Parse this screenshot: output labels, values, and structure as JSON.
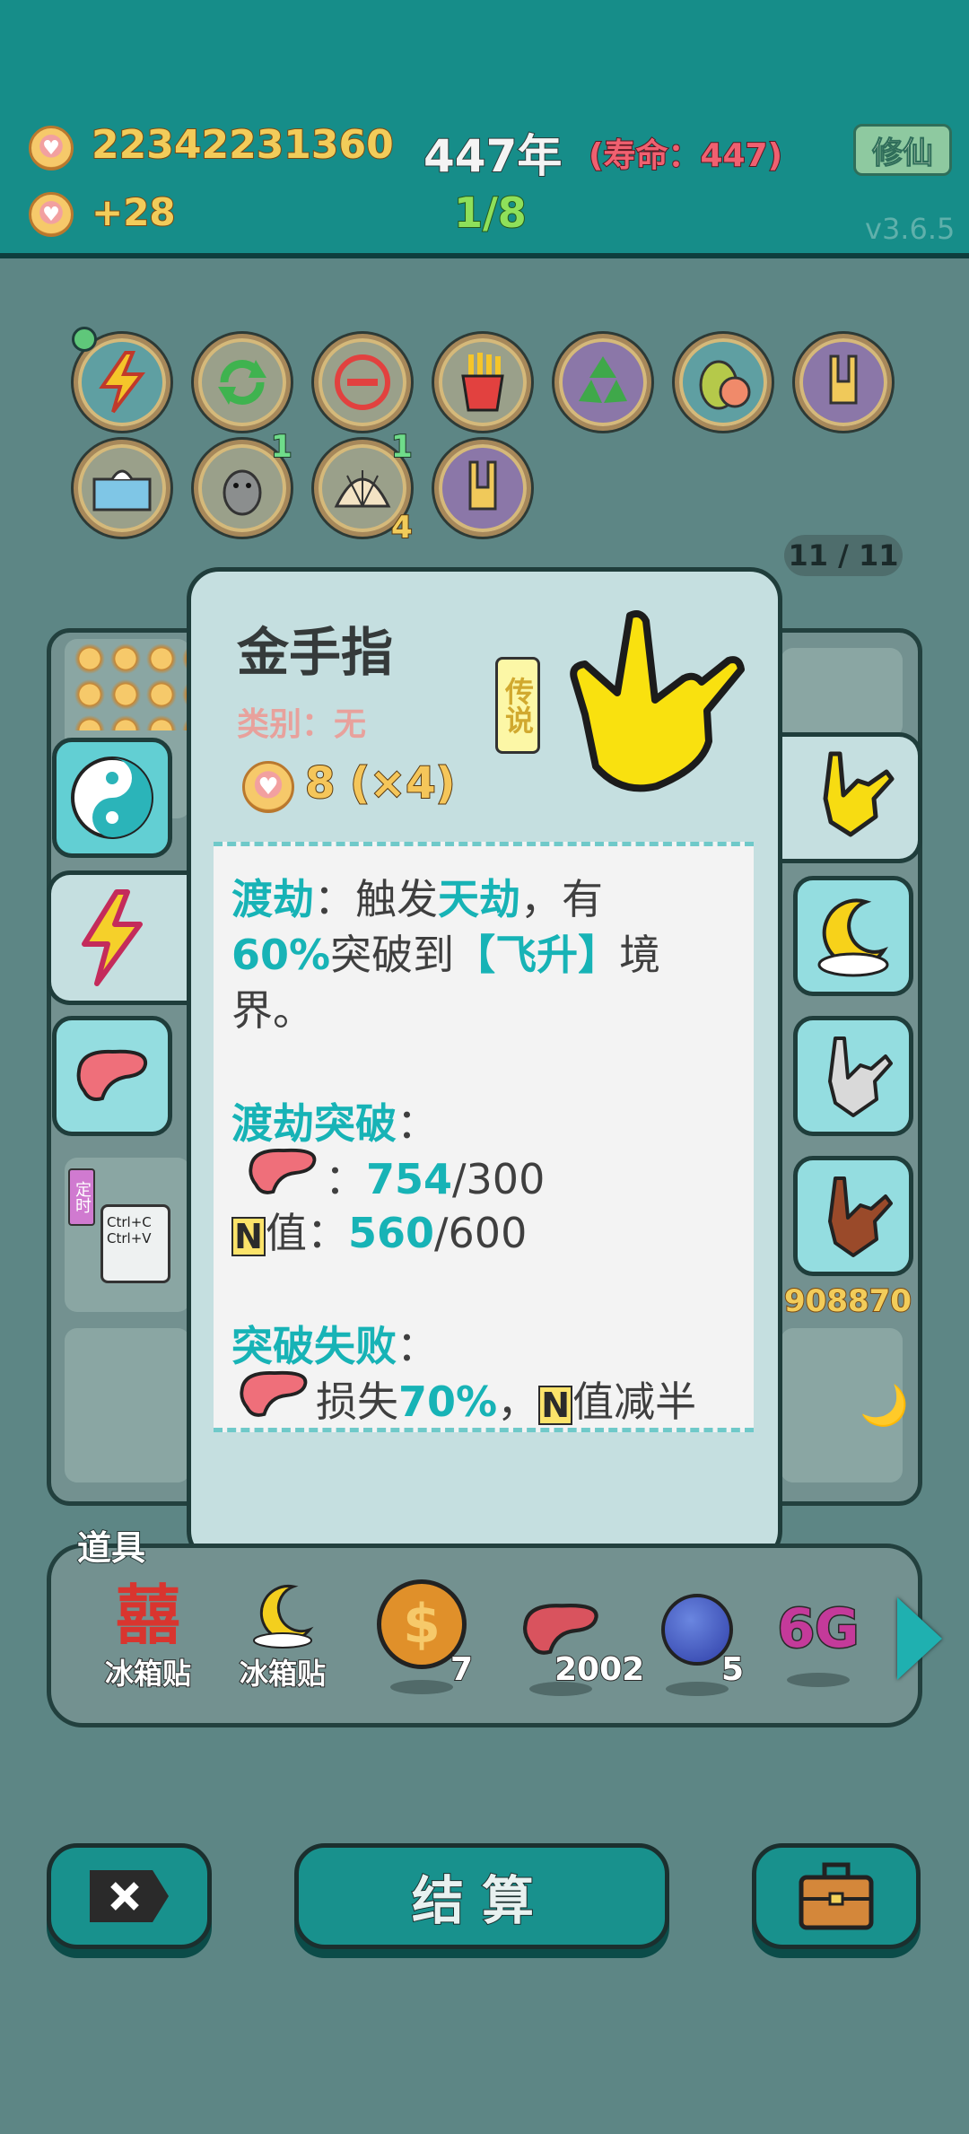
{
  "header": {
    "coins": "22342231360",
    "coin_gain": "+28",
    "year": "447年",
    "lifespan": "(寿命：447)",
    "progress": "1/8",
    "cultivate_button": "修仙",
    "version": "v3.6.5"
  },
  "relics": {
    "row1": [
      "lightning-relic",
      "refresh-relic",
      "minus-relic",
      "fries-relic",
      "recycle-relic",
      "pomelo-relic",
      "rock-hand-relic"
    ],
    "row2": [
      {
        "icon": "tissue-relic",
        "top_count": "",
        "bottom_count": ""
      },
      {
        "icon": "dog-relic",
        "top_count": "1",
        "bottom_count": ""
      },
      {
        "icon": "shell-relic",
        "top_count": "1",
        "bottom_count": "4"
      },
      {
        "icon": "rock-hand-relic-2",
        "top_count": "",
        "bottom_count": ""
      }
    ],
    "page_count": "11 / 11"
  },
  "card": {
    "title": "金手指",
    "rarity": "传说",
    "category": "类别：无",
    "price": "8 (×4)",
    "desc": {
      "l1_a": "渡劫",
      "l1_b": "：触发",
      "l1_c": "天劫",
      "l1_d": "，有",
      "l2_a": "60%",
      "l2_b": "突破到",
      "l2_c": "【飞升】",
      "l2_d": "境",
      "l3": "界。",
      "s2_title": "渡劫突破",
      "colon": "：",
      "s2_liver_sep": "：",
      "s2_liver_val": "754",
      "s2_liver_max": "/300",
      "n_label": "N",
      "s2_n_text": "值：",
      "s2_n_val": "560",
      "s2_n_max": "/600",
      "s3_title": "突破失败",
      "s3_a": "损失",
      "s3_b": "70%",
      "s3_c": "，",
      "s3_d": "值减半"
    }
  },
  "board": {
    "hint_key": "Ctrl+C\nCtrl+V",
    "tag": "定时",
    "partial_number": "908870"
  },
  "items": {
    "label": "道具",
    "list": [
      {
        "icon": "double-happiness",
        "glyph": "囍",
        "label": "冰箱贴",
        "count": ""
      },
      {
        "icon": "moon-magnet",
        "glyph": "🌙",
        "label": "冰箱贴",
        "count": ""
      },
      {
        "icon": "dollar-coin",
        "glyph": "$",
        "label": "",
        "count": "7"
      },
      {
        "icon": "liver",
        "glyph": "",
        "label": "",
        "count": "2002"
      },
      {
        "icon": "blueberry",
        "glyph": "",
        "label": "",
        "count": "5"
      },
      {
        "icon": "6g",
        "glyph": "6G",
        "label": "",
        "count": ""
      }
    ]
  },
  "buttons": {
    "settle": "结算"
  }
}
